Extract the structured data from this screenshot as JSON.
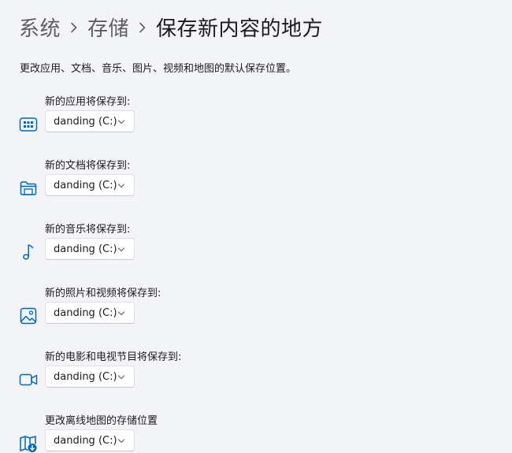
{
  "breadcrumb": {
    "items": [
      "系统",
      "存储"
    ],
    "current": "保存新内容的地方"
  },
  "description": "更改应用、文档、音乐、图片、视频和地图的默认保存位置。",
  "sections": [
    {
      "label": "新的应用将保存到:",
      "icon": "apps-icon",
      "value": "danding (C:)"
    },
    {
      "label": "新的文档将保存到:",
      "icon": "folder-icon",
      "value": "danding (C:)"
    },
    {
      "label": "新的音乐将保存到:",
      "icon": "music-note-icon",
      "value": "danding (C:)"
    },
    {
      "label": "新的照片和视频将保存到:",
      "icon": "picture-icon",
      "value": "danding (C:)"
    },
    {
      "label": "新的电影和电视节目将保存到:",
      "icon": "video-camera-icon",
      "value": "danding (C:)"
    },
    {
      "label": "更改离线地图的存储位置",
      "icon": "map-download-icon",
      "value": "danding (C:)"
    }
  ],
  "colors": {
    "background": "#f3f4f8",
    "accent": "#0067c0",
    "text": "#1b1b1b",
    "secondary_text": "#5f5f5f"
  }
}
